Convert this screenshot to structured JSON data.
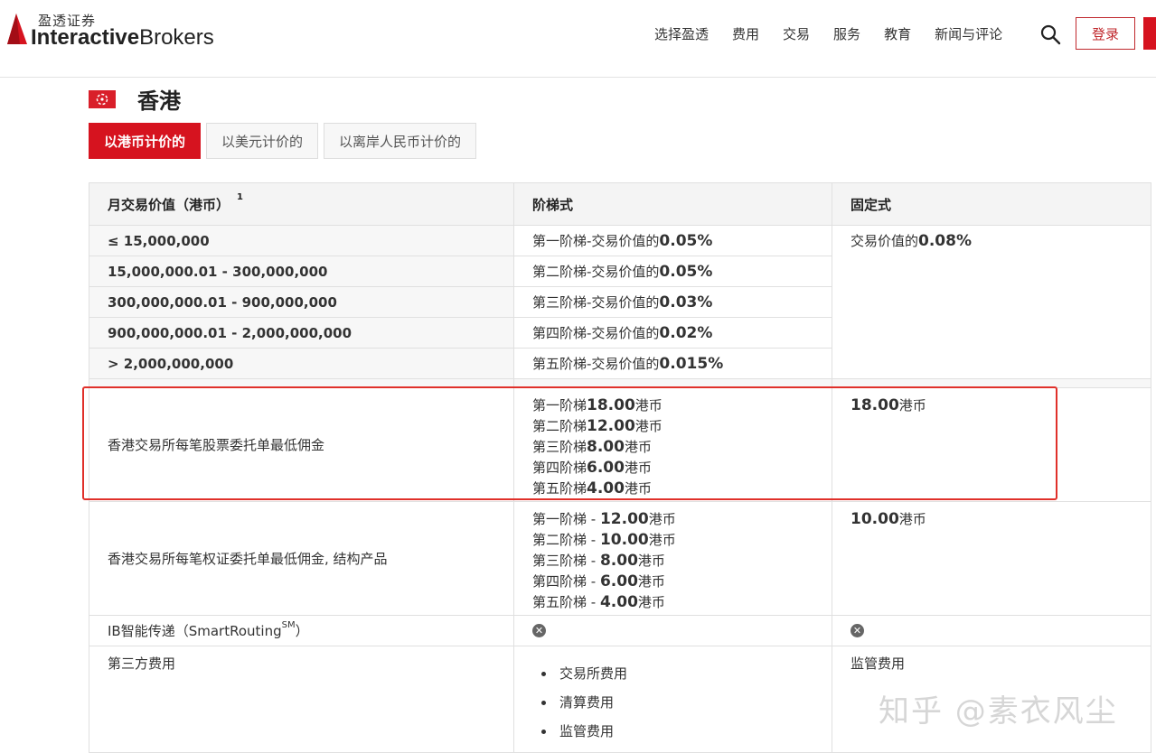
{
  "header": {
    "logo_cn": "盈透证券",
    "logo_en_bold": "Interactive",
    "logo_en_light": "Brokers",
    "nav": [
      "选择盈透",
      "费用",
      "交易",
      "服务",
      "教育",
      "新闻与评论"
    ],
    "login": "登录",
    "accent_color": "#d6131f"
  },
  "page": {
    "title": "香港",
    "tabs": [
      {
        "label": "以港币计价的",
        "active": true
      },
      {
        "label": "以美元计价的",
        "active": false
      },
      {
        "label": "以离岸人民币计价的",
        "active": false
      }
    ]
  },
  "table": {
    "headers": {
      "col1": "月交易价值（港币）",
      "col1_sup": "1",
      "col2": "阶梯式",
      "col3": "固定式"
    },
    "tiers": [
      {
        "range": "≤ 15,000,000",
        "prefix": "第一阶梯-交易价值的",
        "rate": "0.05%"
      },
      {
        "range": "15,000,000.01 - 300,000,000",
        "prefix": "第二阶梯-交易价值的",
        "rate": "0.05%"
      },
      {
        "range": "300,000,000.01 - 900,000,000",
        "prefix": "第三阶梯-交易价值的",
        "rate": "0.03%"
      },
      {
        "range": "900,000,000.01 - 2,000,000,000",
        "prefix": "第四阶梯-交易价值的",
        "rate": "0.02%"
      },
      {
        "range": "> 2,000,000,000",
        "prefix": "第五阶梯-交易价值的",
        "rate": "0.015%"
      }
    ],
    "fixed_rate_prefix": "交易价值的",
    "fixed_rate": "0.08%",
    "stock_min": {
      "label": "香港交易所每笔股票委托单最低佣金",
      "tiers": [
        {
          "prefix": "第一阶梯",
          "amount": "18.00",
          "unit": "港币"
        },
        {
          "prefix": "第二阶梯",
          "amount": "12.00",
          "unit": "港币"
        },
        {
          "prefix": "第三阶梯",
          "amount": "8.00",
          "unit": "港币"
        },
        {
          "prefix": "第四阶梯",
          "amount": "6.00",
          "unit": "港币"
        },
        {
          "prefix": "第五阶梯",
          "amount": "4.00",
          "unit": "港币"
        }
      ],
      "fixed_amount": "18.00",
      "fixed_unit": "港币"
    },
    "warrant_min": {
      "label": "香港交易所每笔权证委托单最低佣金, 结构产品",
      "tiers": [
        {
          "prefix": "第一阶梯 - ",
          "amount": "12.00",
          "unit": "港币"
        },
        {
          "prefix": "第二阶梯 - ",
          "amount": "10.00",
          "unit": "港币"
        },
        {
          "prefix": "第三阶梯 - ",
          "amount": "8.00",
          "unit": "港币"
        },
        {
          "prefix": "第四阶梯 - ",
          "amount": "6.00",
          "unit": "港币"
        },
        {
          "prefix": "第五阶梯 - ",
          "amount": "4.00",
          "unit": "港币"
        }
      ],
      "fixed_amount": "10.00",
      "fixed_unit": "港币"
    },
    "smart_routing": {
      "label": "IB智能传递（SmartRouting",
      "sup": "SM",
      "suffix": "）",
      "tiered_icon": "x-circle-icon",
      "fixed_icon": "x-circle-icon"
    },
    "third_party": {
      "label": "第三方费用",
      "tiered_items": [
        "交易所费用",
        "清算费用",
        "监管费用"
      ],
      "fixed": "监管费用"
    }
  },
  "watermark": "知乎 @素衣风尘"
}
